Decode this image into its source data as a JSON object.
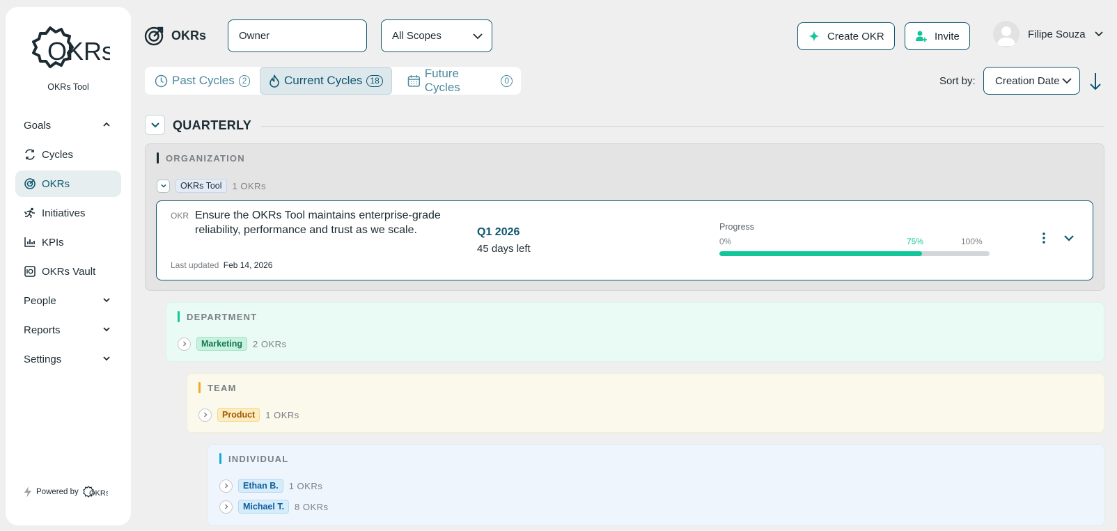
{
  "sidebar": {
    "logo_text": "OKRs",
    "subtitle": "OKRs Tool",
    "items": [
      {
        "label": "Goals"
      },
      {
        "label": "Cycles"
      },
      {
        "label": "OKRs"
      },
      {
        "label": "Initiatives"
      },
      {
        "label": "KPIs"
      },
      {
        "label": "OKRs Vault"
      },
      {
        "label": "People"
      },
      {
        "label": "Reports"
      },
      {
        "label": "Settings"
      }
    ],
    "powered_by": "Powered by",
    "powered_logo": "OKRs"
  },
  "header": {
    "title": "OKRs",
    "owner_placeholder": "Owner",
    "scope_value": "All Scopes",
    "create_label": "Create OKR",
    "invite_label": "Invite",
    "user_name": "Filipe Souza"
  },
  "tabs": [
    {
      "label": "Past Cycles",
      "count": "2"
    },
    {
      "label": "Current Cycles",
      "count": "18"
    },
    {
      "label": "Future Cycles",
      "count": "0"
    }
  ],
  "sort": {
    "label": "Sort by:",
    "value": "Creation Date"
  },
  "quarterly": {
    "label": "QUARTERLY",
    "organization": {
      "label": "ORGANIZATION",
      "group": {
        "tag": "OKRs Tool",
        "count": "1 OKRs"
      },
      "okr": {
        "type": "OKR",
        "title": "Ensure the OKRs Tool maintains enterprise-grade reliability, performance and trust as we scale.",
        "updated_label": "Last updated",
        "updated_date": "Feb 14, 2026",
        "cycle": "Q1 2026",
        "days_left": "45 days left",
        "progress_label": "Progress",
        "progress_min": "0%",
        "progress_value": "75%",
        "progress_max": "100%",
        "progress": 0.75
      }
    },
    "department": {
      "label": "DEPARTMENT",
      "groups": [
        {
          "tag": "Marketing",
          "count": "2 OKRs"
        }
      ]
    },
    "team": {
      "label": "TEAM",
      "groups": [
        {
          "tag": "Product",
          "count": "1 OKRs"
        }
      ]
    },
    "individual": {
      "label": "INDIVIDUAL",
      "groups": [
        {
          "tag": "Ethan B.",
          "count": "1 OKRs"
        },
        {
          "tag": "Michael T.",
          "count": "8 OKRs"
        }
      ]
    }
  },
  "colors": {
    "primary": "#0e5670",
    "accent": "#12c69a",
    "organization_bar": "#1c2b33",
    "department_bar": "#12c69a",
    "team_bar": "#f5a623",
    "individual_bar": "#1aa8d8"
  }
}
